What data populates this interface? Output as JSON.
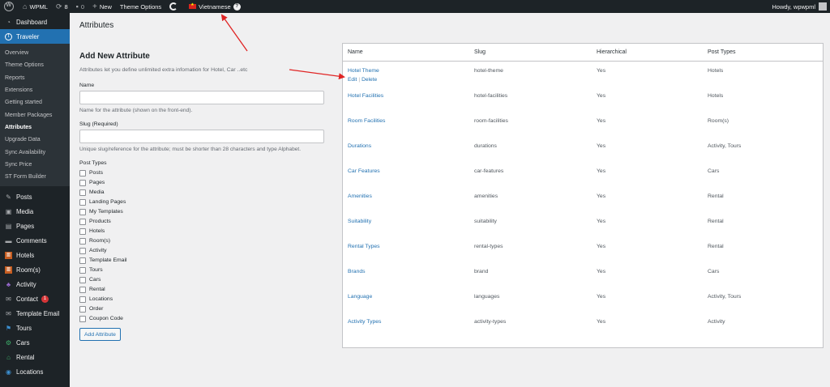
{
  "adminbar": {
    "site": "WPML",
    "updates": "8",
    "comments": "0",
    "new": "New",
    "theme_options": "Theme Options",
    "language": "Vietnamese",
    "language_badge": "?",
    "howdy": "Howdy, wpwpml"
  },
  "sidebar": {
    "dashboard": "Dashboard",
    "traveler": "Traveler",
    "submenu": [
      "Overview",
      "Theme Options",
      "Reports",
      "Extensions",
      "Getting started",
      "Member Packages",
      "Attributes",
      "Upgrade Data",
      "Sync Availability",
      "Sync Price",
      "ST Form Builder"
    ],
    "items": [
      "Posts",
      "Media",
      "Pages",
      "Comments",
      "Hotels",
      "Room(s)",
      "Activity",
      "Contact",
      "Template Email",
      "Tours",
      "Cars",
      "Rental",
      "Locations"
    ],
    "contact_badge": "1"
  },
  "page": {
    "title": "Attributes"
  },
  "form": {
    "title": "Add New Attribute",
    "description": "Attributes let you define unlimited extra infomation for Hotel, Car ..etc",
    "name_label": "Name",
    "name_value": "",
    "name_hint": "Name for the attribute (shown on the front-end).",
    "slug_label": "Slug (Required)",
    "slug_value": "",
    "slug_hint": "Unique slug/reference for the attribute; must be shorter than 28 characters and type Alphabet.",
    "post_types_label": "Post Types",
    "post_types": [
      "Posts",
      "Pages",
      "Media",
      "Landing Pages",
      "My Templates",
      "Products",
      "Hotels",
      "Room(s)",
      "Activity",
      "Template Email",
      "Tours",
      "Cars",
      "Rental",
      "Locations",
      "Order",
      "Coupon Code"
    ],
    "submit": "Add Attribute"
  },
  "table": {
    "headers": [
      "Name",
      "Slug",
      "Hierarchical",
      "Post Types"
    ],
    "row_actions": {
      "edit": "Edit",
      "sep": "|",
      "delete": "Delete"
    },
    "rows": [
      {
        "name": "Hotel Theme",
        "slug": "hotel-theme",
        "hierarchical": "Yes",
        "post_types": "Hotels"
      },
      {
        "name": "Hotel Facilities",
        "slug": "hotel-facilities",
        "hierarchical": "Yes",
        "post_types": "Hotels"
      },
      {
        "name": "Room Facilities",
        "slug": "room-facilities",
        "hierarchical": "Yes",
        "post_types": "Room(s)"
      },
      {
        "name": "Durations",
        "slug": "durations",
        "hierarchical": "Yes",
        "post_types": "Activity, Tours"
      },
      {
        "name": "Car Features",
        "slug": "car-features",
        "hierarchical": "Yes",
        "post_types": "Cars"
      },
      {
        "name": "Amenities",
        "slug": "amenities",
        "hierarchical": "Yes",
        "post_types": "Rental"
      },
      {
        "name": "Suitability",
        "slug": "suitability",
        "hierarchical": "Yes",
        "post_types": "Rental"
      },
      {
        "name": "Rental Types",
        "slug": "rental-types",
        "hierarchical": "Yes",
        "post_types": "Rental"
      },
      {
        "name": "Brands",
        "slug": "brand",
        "hierarchical": "Yes",
        "post_types": "Cars"
      },
      {
        "name": "Language",
        "slug": "languages",
        "hierarchical": "Yes",
        "post_types": "Activity, Tours"
      },
      {
        "name": "Activity Types",
        "slug": "activity-types",
        "hierarchical": "Yes",
        "post_types": "Activity"
      }
    ]
  },
  "colors": {
    "accent": "#2271b1",
    "adminbar": "#1d2327",
    "arrow": "#e02424"
  }
}
